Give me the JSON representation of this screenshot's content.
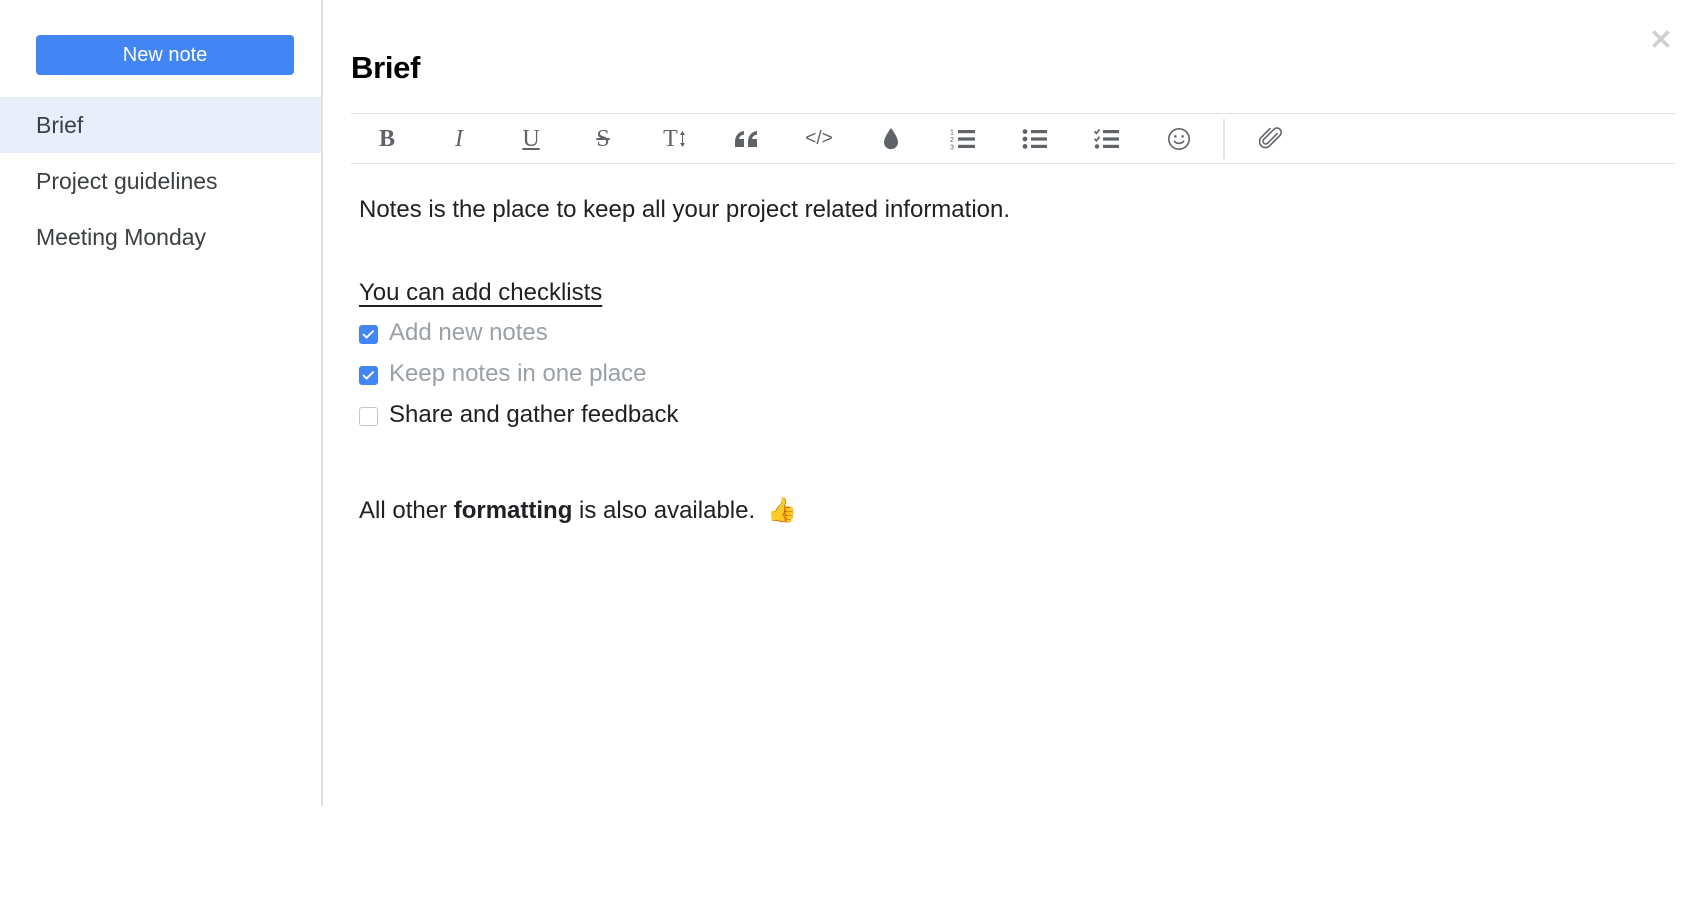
{
  "sidebar": {
    "new_note_label": "New note",
    "items": [
      {
        "label": "Brief",
        "selected": true
      },
      {
        "label": "Project guidelines",
        "selected": false
      },
      {
        "label": "Meeting Monday",
        "selected": false
      }
    ]
  },
  "editor": {
    "title": "Brief",
    "toolbar": {
      "items": [
        {
          "name": "bold-icon",
          "glyph": "B",
          "tooltip": "Bold"
        },
        {
          "name": "italic-icon",
          "glyph": "I",
          "tooltip": "Italic"
        },
        {
          "name": "underline-icon",
          "glyph": "U",
          "tooltip": "Underline"
        },
        {
          "name": "strikethrough-icon",
          "glyph": "S",
          "tooltip": "Strikethrough"
        },
        {
          "name": "text-size-icon",
          "glyph": "T",
          "tooltip": "Text size"
        },
        {
          "name": "blockquote-icon",
          "glyph": "“",
          "tooltip": "Quote"
        },
        {
          "name": "code-icon",
          "glyph": "</>",
          "tooltip": "Code"
        },
        {
          "name": "highlight-color-icon",
          "glyph": "",
          "tooltip": "Highlight color"
        },
        {
          "name": "numbered-list-icon",
          "glyph": "",
          "tooltip": "Numbered list"
        },
        {
          "name": "bulleted-list-icon",
          "glyph": "",
          "tooltip": "Bulleted list"
        },
        {
          "name": "checklist-icon",
          "glyph": "",
          "tooltip": "Checklist"
        },
        {
          "name": "emoji-icon",
          "glyph": "",
          "tooltip": "Emoji"
        },
        {
          "name": "attachment-icon",
          "glyph": "",
          "tooltip": "Attach file"
        }
      ]
    },
    "body": {
      "intro": "Notes is the place to keep all your project related information.",
      "checklist_heading": "You can add checklists",
      "checklist": [
        {
          "label": "Add new notes",
          "checked": true
        },
        {
          "label": "Keep notes in one place",
          "checked": true
        },
        {
          "label": "Share and gather feedback",
          "checked": false
        }
      ],
      "closing_prefix": "All other ",
      "closing_bold": "formatting",
      "closing_suffix": " is also available.",
      "closing_emoji": "👍"
    }
  },
  "window": {
    "close_label": "✕"
  },
  "colors": {
    "accent": "#4285f4",
    "selected_row": "#e8eefa",
    "done_text": "#9aa0a6",
    "divider": "#e0e0e0",
    "toolbar_icon": "#5f6368",
    "close_icon": "#cfcfcf"
  }
}
